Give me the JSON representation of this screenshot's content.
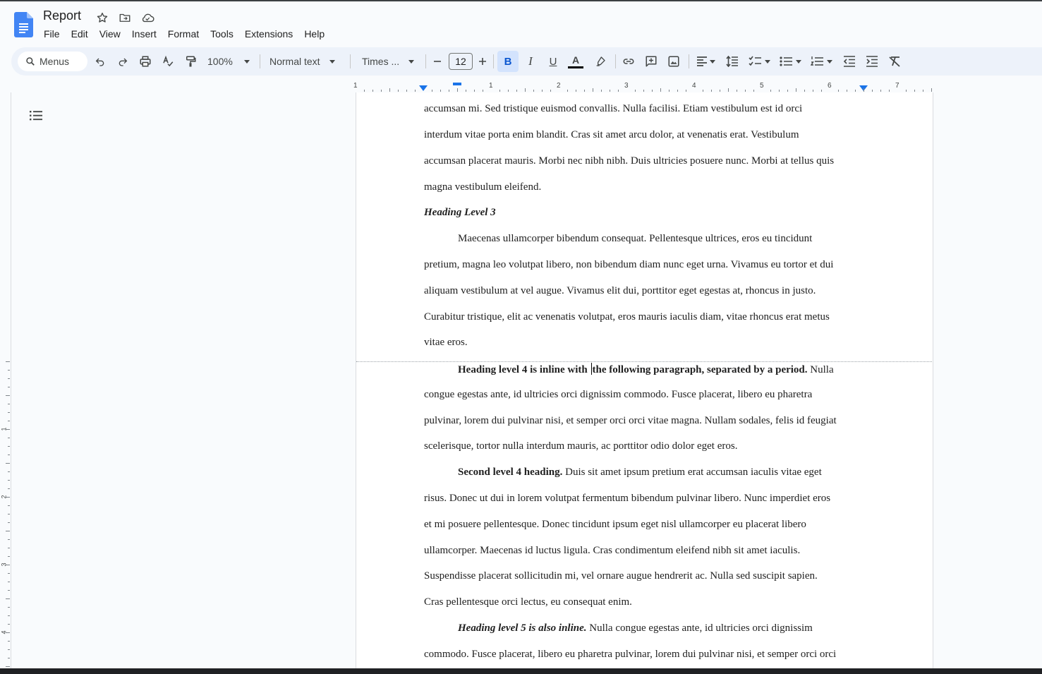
{
  "app": {
    "title": "Report",
    "menus": [
      "File",
      "Edit",
      "View",
      "Insert",
      "Format",
      "Tools",
      "Extensions",
      "Help"
    ],
    "accent_color": "#1a73e8"
  },
  "toolbar": {
    "search_label": "Menus",
    "zoom": "100%",
    "style": "Normal text",
    "font": "Times ...",
    "font_size": "12",
    "bold_label": "B",
    "italic_label": "I",
    "underline_label": "U",
    "text_color_label": "A"
  },
  "ruler": {
    "labels": [
      "1",
      "1",
      "2",
      "3",
      "4",
      "5",
      "6",
      "7"
    ]
  },
  "vruler": {
    "labels": [
      "1",
      "2",
      "3",
      "4"
    ]
  },
  "document": {
    "lines": [
      {
        "segments": [
          {
            "t": "accumsan mi. Sed tristique euismod convallis. Nulla facilisi. Etiam vestibulum est id orci",
            "s": "n"
          }
        ]
      },
      {
        "segments": [
          {
            "t": "interdum vitae porta enim blandit. Cras sit amet arcu dolor, at venenatis erat. Vestibulum",
            "s": "n"
          }
        ]
      },
      {
        "segments": [
          {
            "t": "accumsan placerat mauris. Morbi nec nibh nibh. Duis ultricies posuere nunc. Morbi at tellus quis",
            "s": "n"
          }
        ]
      },
      {
        "segments": [
          {
            "t": "magna vestibulum eleifend.",
            "s": "n"
          }
        ]
      },
      {
        "segments": [
          {
            "t": "Heading Level 3",
            "s": "bi"
          }
        ]
      },
      {
        "indent": true,
        "segments": [
          {
            "t": "Maecenas ullamcorper bibendum consequat. Pellentesque ultrices, eros eu tincidunt",
            "s": "n"
          }
        ]
      },
      {
        "segments": [
          {
            "t": "pretium, magna leo volutpat libero, non bibendum diam nunc eget urna. Vivamus eu tortor et dui",
            "s": "n"
          }
        ]
      },
      {
        "segments": [
          {
            "t": "aliquam vestibulum at vel augue. Vivamus elit dui, porttitor eget egestas at, rhoncus in justo.",
            "s": "n"
          }
        ]
      },
      {
        "segments": [
          {
            "t": "Curabitur tristique, elit ac venenatis volutpat, eros mauris iaculis diam, vitae rhoncus erat metus",
            "s": "n"
          }
        ]
      },
      {
        "segments": [
          {
            "t": "vitae eros.",
            "s": "n"
          }
        ]
      },
      {
        "indent": true,
        "segments": [
          {
            "t": "Heading level 4 is inline with ",
            "s": "b"
          },
          {
            "t": "",
            "s": "cursor"
          },
          {
            "t": "the following paragraph, separated by a period.",
            "s": "b"
          },
          {
            "t": " Nulla",
            "s": "n"
          }
        ]
      },
      {
        "segments": [
          {
            "t": "congue egestas ante, id ultricies orci dignissim commodo. Fusce placerat, libero eu pharetra",
            "s": "n"
          }
        ]
      },
      {
        "segments": [
          {
            "t": "pulvinar, lorem dui pulvinar nisi, et semper orci orci vitae magna. Nullam sodales, felis id feugiat",
            "s": "n"
          }
        ]
      },
      {
        "segments": [
          {
            "t": "scelerisque, tortor nulla interdum mauris, ac porttitor odio dolor eget eros.",
            "s": "n"
          }
        ]
      },
      {
        "indent": true,
        "segments": [
          {
            "t": "Second level 4 heading.",
            "s": "b"
          },
          {
            "t": " Duis sit amet ipsum pretium erat accumsan iaculis vitae eget",
            "s": "n"
          }
        ]
      },
      {
        "segments": [
          {
            "t": "risus. Donec ut dui in lorem volutpat fermentum bibendum pulvinar libero. Nunc imperdiet eros",
            "s": "n"
          }
        ]
      },
      {
        "segments": [
          {
            "t": "et mi posuere pellentesque. Donec tincidunt ipsum eget nisl ullamcorper eu placerat libero",
            "s": "n"
          }
        ]
      },
      {
        "segments": [
          {
            "t": "ullamcorper. Maecenas id luctus ligula. Cras condimentum eleifend nibh sit amet iaculis.",
            "s": "n"
          }
        ]
      },
      {
        "segments": [
          {
            "t": "Suspendisse placerat sollicitudin mi, vel ornare augue hendrerit ac. Nulla sed suscipit sapien.",
            "s": "n"
          }
        ]
      },
      {
        "segments": [
          {
            "t": "Cras pellentesque orci lectus, eu consequat enim.",
            "s": "n"
          }
        ]
      },
      {
        "indent": true,
        "segments": [
          {
            "t": "Heading level 5 is also inline.",
            "s": "bi"
          },
          {
            "t": " Nulla congue egestas ante, id ultricies orci dignissim",
            "s": "n"
          }
        ]
      },
      {
        "segments": [
          {
            "t": "commodo. Fusce placerat, libero eu pharetra pulvinar, lorem dui pulvinar nisi, et semper orci orci",
            "s": "n"
          }
        ]
      }
    ]
  }
}
